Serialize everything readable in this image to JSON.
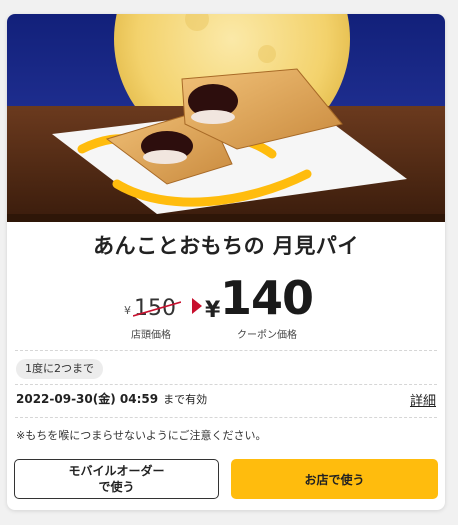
{
  "coupon": {
    "image_alt": "あんことおもちの 月見パイ",
    "title": "あんことおもちの 月見パイ",
    "original_price_symbol": "¥",
    "original_price": "150",
    "original_price_label": "店頭価格",
    "coupon_price_symbol": "¥",
    "coupon_price": "140",
    "coupon_price_label": "クーポン価格",
    "limit_text": "1度に2つまで",
    "expiry_date": "2022-09-30(金) 04:59",
    "expiry_suffix": "まで有効",
    "detail_label": "詳細",
    "notice": "※もちを喉につまらせないようにご注意ください。",
    "mobile_order_button_line1": "モバイルオーダー",
    "mobile_order_button_line2": "で使う",
    "store_button": "お店で使う"
  },
  "colors": {
    "accent_yellow": "#ffbc0d",
    "price_arrow_red": "#c8102e",
    "night_sky": "#1c2a86"
  }
}
